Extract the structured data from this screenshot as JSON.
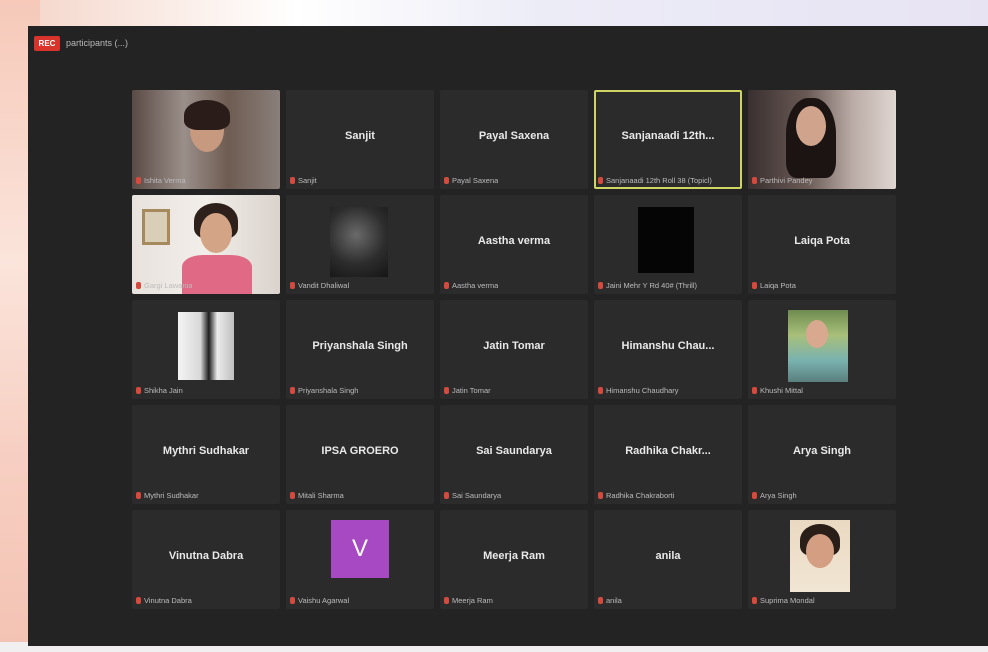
{
  "header": {
    "rec_badge": "REC",
    "meeting_label": "participants (...)"
  },
  "tiles": [
    {
      "center_name": "",
      "label": "Ishita Verma"
    },
    {
      "center_name": "Sanjit",
      "label": "Sanjit"
    },
    {
      "center_name": "Payal Saxena",
      "label": "Payal Saxena"
    },
    {
      "center_name": "Sanjanaadi 12th...",
      "label": "Sanjanaadi 12th Roll 38 (Topicl)"
    },
    {
      "center_name": "",
      "label": "Parthivi Pandey"
    },
    {
      "center_name": "",
      "label": "Gargi Lawania"
    },
    {
      "center_name": "",
      "label": "Vandit Dhaliwal"
    },
    {
      "center_name": "Aastha verma",
      "label": "Aastha verma"
    },
    {
      "center_name": "",
      "label": "Jaini Mehr Y Rd 40# (Thrill)"
    },
    {
      "center_name": "Laiqa Pota",
      "label": "Laiqa Pota"
    },
    {
      "center_name": "",
      "label": "Shikha Jain"
    },
    {
      "center_name": "Priyanshala Singh",
      "label": "Priyanshala Singh"
    },
    {
      "center_name": "Jatin Tomar",
      "label": "Jatin Tomar"
    },
    {
      "center_name": "Himanshu Chau...",
      "label": "Himanshu Chaudhary"
    },
    {
      "center_name": "",
      "label": "Khushi Mittal"
    },
    {
      "center_name": "Mythri Sudhakar",
      "label": "Mythri Sudhakar"
    },
    {
      "center_name": "IPSA GROERO",
      "label": "Mitali Sharma"
    },
    {
      "center_name": "Sai Saundarya",
      "label": "Sai Saundarya"
    },
    {
      "center_name": "Radhika Chakr...",
      "label": "Radhika Chakraborti"
    },
    {
      "center_name": "Arya Singh",
      "label": "Arya Singh"
    },
    {
      "center_name": "Vinutna Dabra",
      "label": "Vinutna Dabra"
    },
    {
      "center_name": "",
      "label": "Vaishu Agarwal",
      "avatar": "V"
    },
    {
      "center_name": "Meerja Ram",
      "label": "Meerja Ram"
    },
    {
      "center_name": "anila",
      "label": "anila"
    },
    {
      "center_name": "",
      "label": "Suprima Mondal"
    }
  ]
}
